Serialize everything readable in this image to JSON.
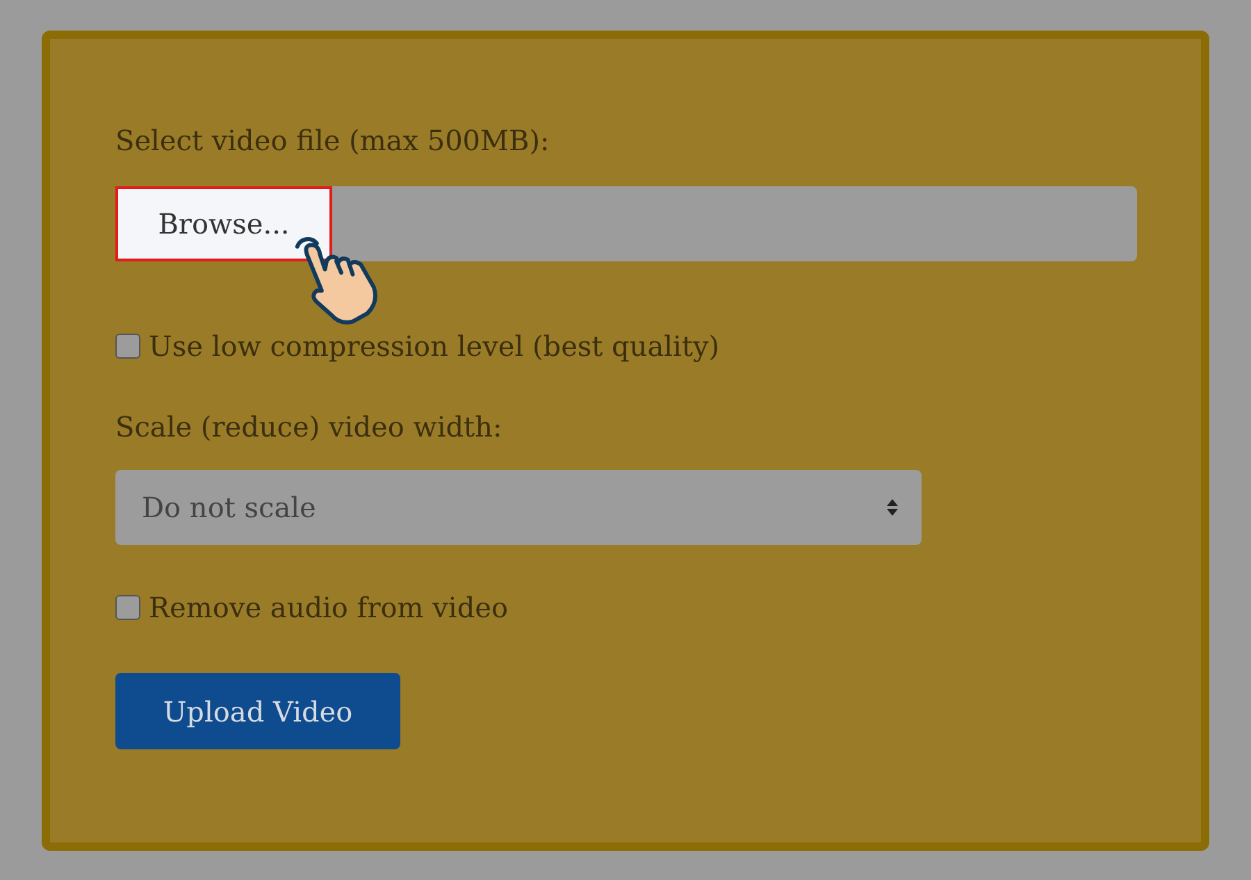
{
  "form": {
    "file_label": "Select video file (max 500MB):",
    "browse_button": {
      "label": "Browse...",
      "highlighted": true
    },
    "low_compression": {
      "label": "Use low compression level (best quality)",
      "checked": false
    },
    "scale_label": "Scale (reduce) video width:",
    "scale_select": {
      "value": "Do not scale"
    },
    "remove_audio": {
      "label": "Remove audio from video",
      "checked": false
    },
    "submit_button": "Upload Video"
  }
}
